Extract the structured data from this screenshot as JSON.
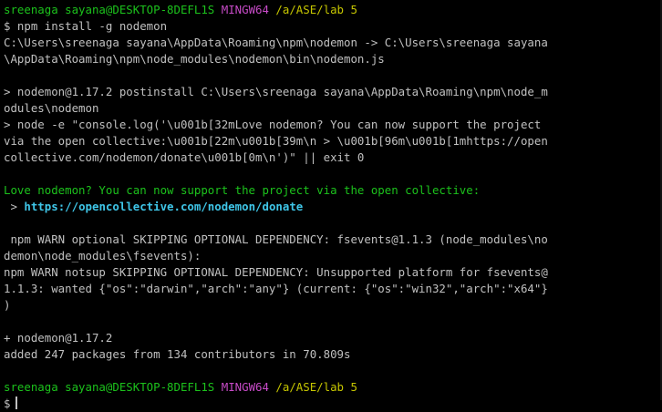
{
  "prompt1": {
    "user_host": "sreenaga sayana@DESKTOP-8DEFL1S",
    "shell": "MINGW64",
    "path": "/a/ASE/lab 5"
  },
  "cmd1": "$ npm install -g nodemon",
  "output": {
    "l1": "C:\\Users\\sreenaga sayana\\AppData\\Roaming\\npm\\nodemon -> C:\\Users\\sreenaga sayana",
    "l2": "\\AppData\\Roaming\\npm\\node_modules\\nodemon\\bin\\nodemon.js",
    "l3": "> nodemon@1.17.2 postinstall C:\\Users\\sreenaga sayana\\AppData\\Roaming\\npm\\node_m",
    "l4": "odules\\nodemon",
    "l5": "> node -e \"console.log('\\u001b[32mLove nodemon? You can now support the project",
    "l6": "via the open collective:\\u001b[22m\\u001b[39m\\n > \\u001b[96m\\u001b[1mhttps://open",
    "l7": "collective.com/nodemon/donate\\u001b[0m\\n')\" || exit 0",
    "l8": "Love nodemon? You can now support the project via the open collective:",
    "l9_prefix": " > ",
    "l9_link": "https://opencollective.com/nodemon/donate",
    "l10": " npm WARN optional SKIPPING OPTIONAL DEPENDENCY: fsevents@1.1.3 (node_modules\\no",
    "l11": "demon\\node_modules\\fsevents):",
    "l12": "npm WARN notsup SKIPPING OPTIONAL DEPENDENCY: Unsupported platform for fsevents@",
    "l13": "1.1.3: wanted {\"os\":\"darwin\",\"arch\":\"any\"} (current: {\"os\":\"win32\",\"arch\":\"x64\"}",
    "l14": ")",
    "l15": "+ nodemon@1.17.2",
    "l16": "added 247 packages from 134 contributors in 70.809s"
  },
  "prompt2": {
    "user_host": "sreenaga sayana@DESKTOP-8DEFL1S",
    "shell": "MINGW64",
    "path": "/a/ASE/lab 5"
  },
  "cmd2": "$",
  "colors": {
    "background": "#000000",
    "text": "#c0c0c0",
    "prompt_user": "#1cc21c",
    "prompt_shell": "#c84bc8",
    "prompt_path": "#c6c600",
    "link": "#3fc6e8"
  }
}
